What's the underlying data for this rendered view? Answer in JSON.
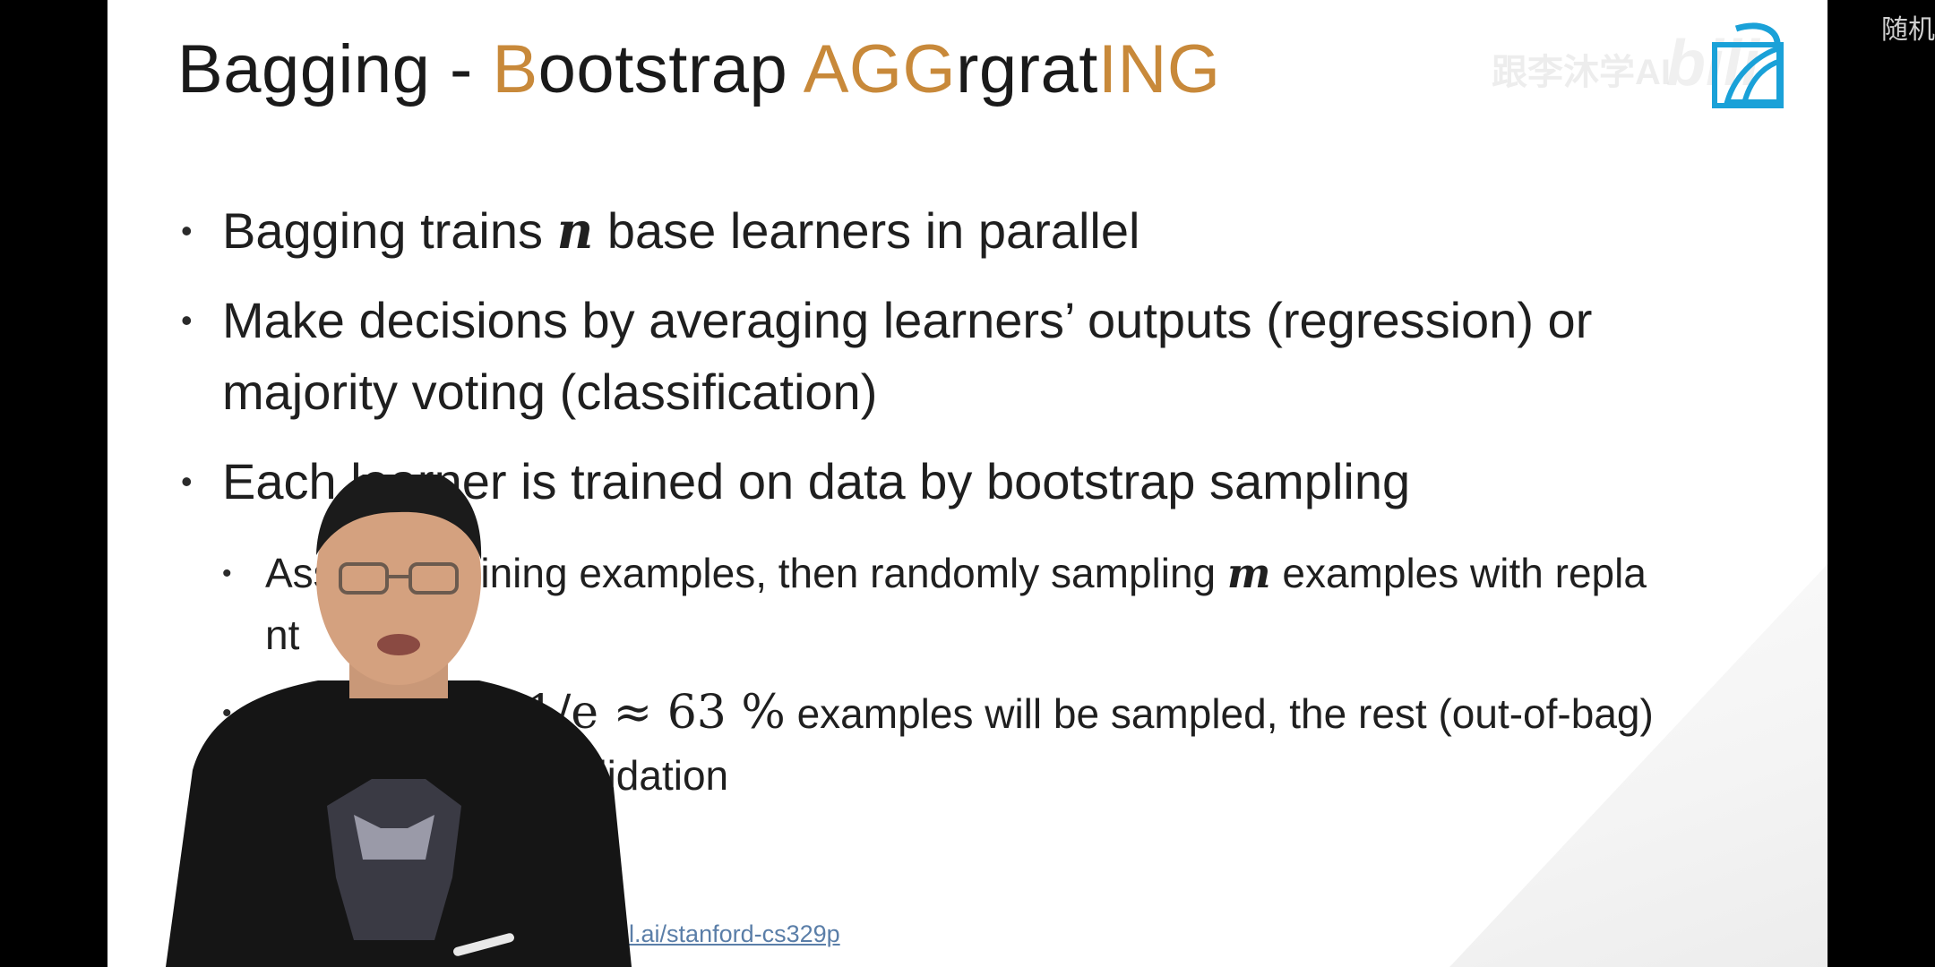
{
  "title": {
    "parts": [
      {
        "text": "Bagging - ",
        "highlight": false
      },
      {
        "text": "B",
        "highlight": true
      },
      {
        "text": "ootstrap ",
        "highlight": false
      },
      {
        "text": "AGG",
        "highlight": true
      },
      {
        "text": "rgrat",
        "highlight": false
      },
      {
        "text": "ING",
        "highlight": true
      }
    ]
  },
  "bullets": [
    {
      "level": 1,
      "segments": [
        {
          "text": "Bagging trains ",
          "math": false
        },
        {
          "text": "n",
          "math": true
        },
        {
          "text": " base learners in parallel",
          "math": false
        }
      ]
    },
    {
      "level": 1,
      "segments": [
        {
          "text": "Make decisions by averaging learners’ outputs (regression) or majority voting (classification)",
          "math": false
        }
      ]
    },
    {
      "level": 1,
      "segments": [
        {
          "text": "Each learner is trained on data by bootstrap sampling",
          "math": false
        }
      ]
    },
    {
      "level": 2,
      "segments": [
        {
          "text": "Ass",
          "math": false
        },
        {
          "text": "training examples, then randomly sampling ",
          "math": false
        },
        {
          "text": "m",
          "math": true
        },
        {
          "text": " examples with repla",
          "math": false
        },
        {
          "text": "nt",
          "math": false
        }
      ]
    },
    {
      "level": 2,
      "segments": [
        {
          "text": "A",
          "math": false
        },
        {
          "text": "1/e ≈ 63 %",
          "math": "upright"
        },
        {
          "text": "  examples will be sampled, the rest (out-of-bag)",
          "math": false
        },
        {
          "text": " validation",
          "math": false
        }
      ]
    }
  ],
  "footer_link": "d2l.ai/stanford-cs329p",
  "watermark": "跟李沐学AI",
  "corner_text": "随机",
  "colors": {
    "accent": "#c8893a",
    "logo": "#1aa1d8",
    "link": "#5a7ea8"
  },
  "icons": {
    "logo": "bilibili-d2l-logo-icon"
  }
}
